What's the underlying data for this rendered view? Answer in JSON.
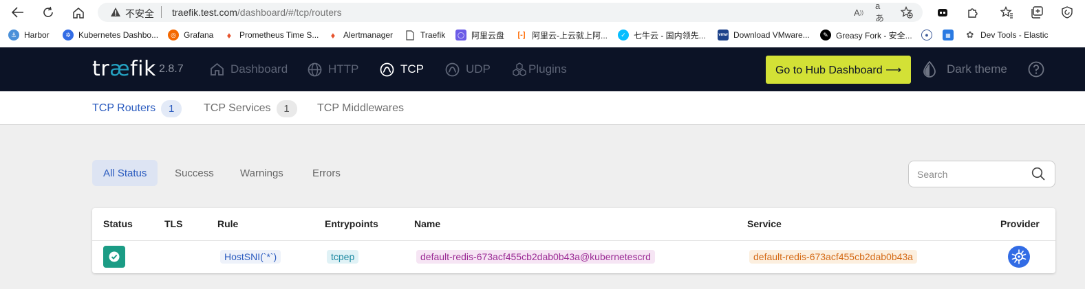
{
  "browser": {
    "insecure_label": "不安全",
    "url_host": "traefik.test.com",
    "url_path": "/dashboard/#/tcp/routers",
    "bookmarks": [
      {
        "label": "Harbor",
        "icon": "harbor-icon",
        "color": "#4a90d9"
      },
      {
        "label": "Kubernetes Dashbo...",
        "icon": "kubernetes-icon",
        "color": "#326ce5"
      },
      {
        "label": "Grafana",
        "icon": "grafana-icon",
        "color": "#f46800"
      },
      {
        "label": "Prometheus Time S...",
        "icon": "prometheus-icon",
        "color": "#e6522c"
      },
      {
        "label": "Alertmanager",
        "icon": "alertmanager-icon",
        "color": "#e6522c"
      },
      {
        "label": "Traefik",
        "icon": "page-icon",
        "color": "#777777"
      },
      {
        "label": "阿里云盘",
        "icon": "aliyun-drive-icon",
        "color": "#6c5ce7"
      },
      {
        "label": "阿里云-上云就上阿...",
        "icon": "aliyun-icon",
        "color": "#ff6a00"
      },
      {
        "label": "七牛云 - 国内领先...",
        "icon": "qiniu-icon",
        "color": "#07beff"
      },
      {
        "label": "Download VMware...",
        "icon": "vmware-icon",
        "color": "#1d428a"
      },
      {
        "label": "Greasy Fork - 安全...",
        "icon": "greasyfork-icon",
        "color": "#000000"
      },
      {
        "label": "",
        "icon": "bookmark-icon-1",
        "color": "#3b5998"
      },
      {
        "label": "",
        "icon": "bookmark-icon-2",
        "color": "#2a7ae2"
      },
      {
        "label": "Dev Tools - Elastic",
        "icon": "elastic-icon",
        "color": "#666666"
      }
    ]
  },
  "header": {
    "logo_pre": "tr",
    "logo_ae": "æ",
    "logo_post": "fik",
    "version": "2.8.7",
    "nav": [
      {
        "label": "Dashboard",
        "icon": "home-icon",
        "active": false
      },
      {
        "label": "HTTP",
        "icon": "globe-icon",
        "active": false
      },
      {
        "label": "TCP",
        "icon": "tcp-icon",
        "active": true
      },
      {
        "label": "UDP",
        "icon": "udp-icon",
        "active": false
      },
      {
        "label": "Plugins",
        "icon": "plugins-icon",
        "active": false
      }
    ],
    "hub_button": "Go to Hub Dashboard ⟶",
    "dark_theme_label": "Dark theme"
  },
  "subnav": {
    "tabs": [
      {
        "label": "TCP Routers",
        "count": "1",
        "active": true
      },
      {
        "label": "TCP Services",
        "count": "1",
        "active": false
      },
      {
        "label": "TCP Middlewares",
        "count": "",
        "active": false
      }
    ]
  },
  "filters": {
    "items": [
      "All Status",
      "Success",
      "Warnings",
      "Errors"
    ],
    "active": "All Status"
  },
  "search": {
    "placeholder": "Search",
    "value": ""
  },
  "table": {
    "columns": [
      "Status",
      "TLS",
      "Rule",
      "Entrypoints",
      "Name",
      "Service",
      "Provider"
    ],
    "rows": [
      {
        "status": "success",
        "tls": "",
        "rule": "HostSNI(`*`)",
        "entrypoints": "tcpep",
        "name": "default-redis-673acf455cb2dab0b43a@kubernetescrd",
        "service": "default-redis-673acf455cb2dab0b43a",
        "provider": "kubernetes-icon"
      }
    ]
  },
  "colors": {
    "nav_bg": "#0c1326",
    "accent_blue": "#2a5bbf",
    "hub_yellow": "#d3e136",
    "success_green": "#1b9c85"
  }
}
